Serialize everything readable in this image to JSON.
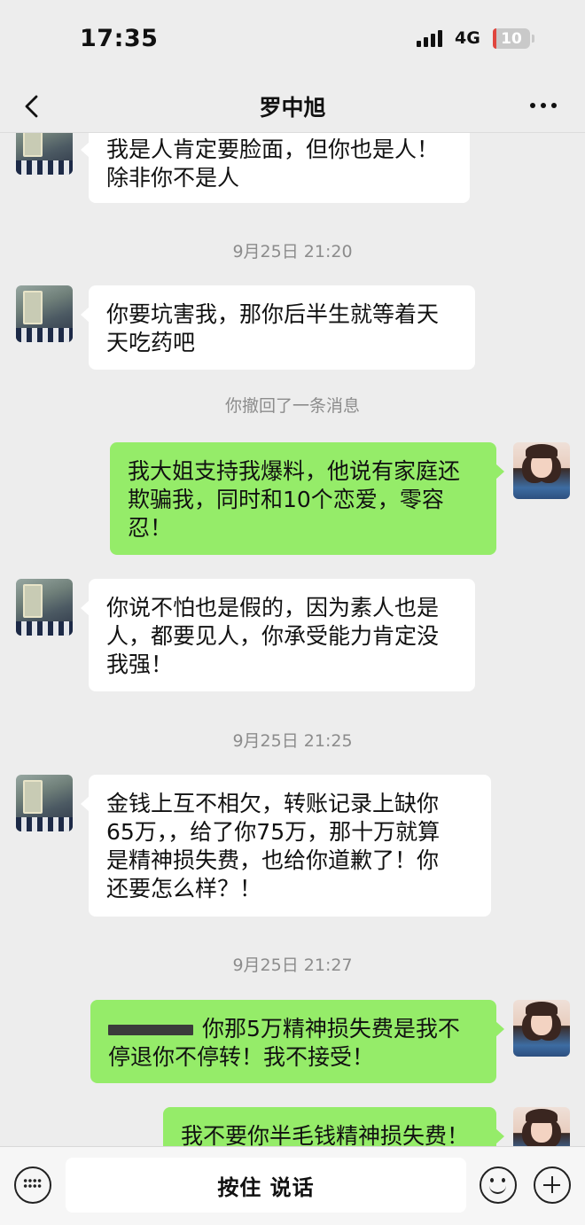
{
  "status_bar": {
    "time": "17:35",
    "network": "4G",
    "battery": "10",
    "battery_level": 0.1
  },
  "nav": {
    "title": "罗中旭"
  },
  "messages": [
    {
      "type": "text",
      "side": "in",
      "lines": [
        "我是人肯定要脸面，但你也是人！",
        "除非你不是人"
      ]
    },
    {
      "type": "time",
      "text": "9月25日 21:20"
    },
    {
      "type": "text",
      "side": "in",
      "lines": [
        "你要坑害我，那你后半生就等着天",
        "天吃药吧"
      ]
    },
    {
      "type": "system",
      "text": "你撤回了一条消息"
    },
    {
      "type": "text",
      "side": "out",
      "lines": [
        "我大姐支持我爆料，他说有家庭还",
        "欺骗我，同时和10个恋爱，零容",
        "忍！"
      ]
    },
    {
      "type": "text",
      "side": "in",
      "lines": [
        "你说不怕也是假的，因为素人也是",
        "人，都要见人，你承受能力肯定没",
        "我强！"
      ]
    },
    {
      "type": "time",
      "text": "9月25日 21:25"
    },
    {
      "type": "text",
      "side": "in",
      "lines": [
        "金钱上互不相欠，转账记录上缺你",
        "65万，，给了你75万，那十万就算",
        "是精神损失费，也给你道歉了！你",
        "还要怎么样？！"
      ]
    },
    {
      "type": "time",
      "text": "9月25日 21:27"
    },
    {
      "type": "text",
      "side": "out",
      "lines": [
        "你那5万精神损失费是我不",
        "停退你不停转！我不接受！"
      ]
    },
    {
      "type": "text",
      "side": "out",
      "lines": [
        "我不要你半毛钱精神损失费！"
      ]
    }
  ],
  "input_bar": {
    "hold_to_talk": "按住 说话"
  },
  "icons": {
    "back": "chevron-left-icon",
    "more": "more-dots-icon",
    "keyboard": "keyboard-icon",
    "emoji": "emoji-icon",
    "plus": "plus-icon"
  },
  "colors": {
    "background": "#ededed",
    "outgoing_bubble": "#95ec69",
    "incoming_bubble": "#ffffff"
  }
}
